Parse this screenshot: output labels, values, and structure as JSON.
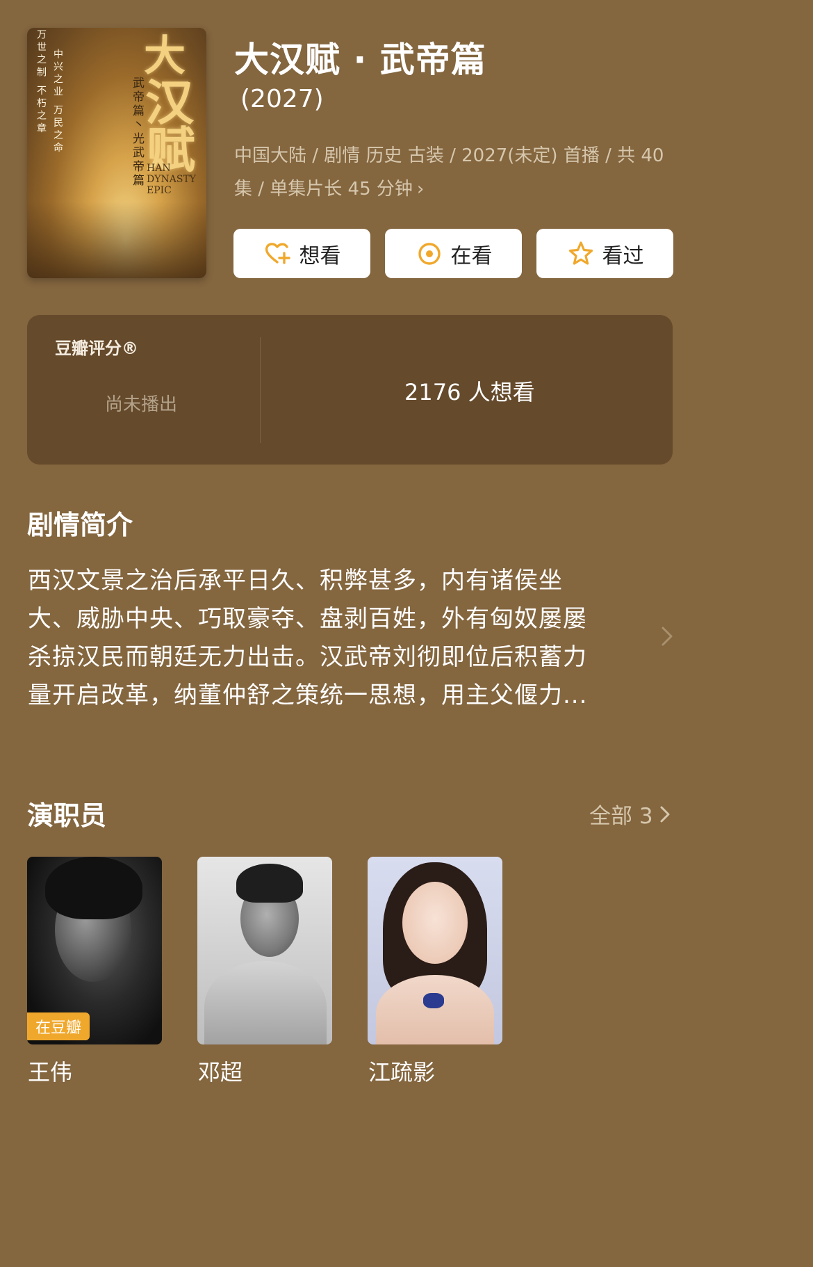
{
  "poster": {
    "title_chars": "大汉赋",
    "subtitle_vertical": "武帝篇丶光武帝篇",
    "english": [
      "HAN",
      "DYNASTY",
      "EPIC"
    ],
    "slogan_col1": "万世之制 不朽之章",
    "slogan_col2": "中兴之业 万民之命"
  },
  "header": {
    "title": "大汉赋 · 武帝篇",
    "year": "(2027)",
    "meta": "中国大陆 / 剧情 历史 古装 / 2027(未定) 首播 / 共 40 集 / 单集片长 45 分钟"
  },
  "actions": {
    "want": "想看",
    "watching": "在看",
    "watched": "看过"
  },
  "rating": {
    "label": "豆瓣评分®",
    "state": "尚未播出",
    "want_count": "2176 人想看"
  },
  "synopsis": {
    "title": "剧情简介",
    "lines": [
      "西汉文景之治后承平日久、积弊甚多，内有诸侯坐",
      "大、威胁中央、巧取豪夺、盘剥百姓，外有匈奴屡屡",
      "杀掠汉民而朝廷无力出击。汉武帝刘彻即位后积蓄力",
      "量开启改革，纳董仲舒之策统一思想，用主父偃力..."
    ]
  },
  "cast": {
    "title": "演职员",
    "all_label": "全部 3",
    "members": [
      {
        "name": "王伟",
        "badge": "在豆瓣"
      },
      {
        "name": "邓超"
      },
      {
        "name": "江疏影"
      }
    ]
  },
  "colors": {
    "background": "#84663f",
    "rating_box": "#654a2c",
    "accent_orange": "#f0a82c"
  },
  "icons": {
    "want": "heart-plus-icon",
    "watching": "target-circle-icon",
    "watched": "star-outline-icon"
  }
}
